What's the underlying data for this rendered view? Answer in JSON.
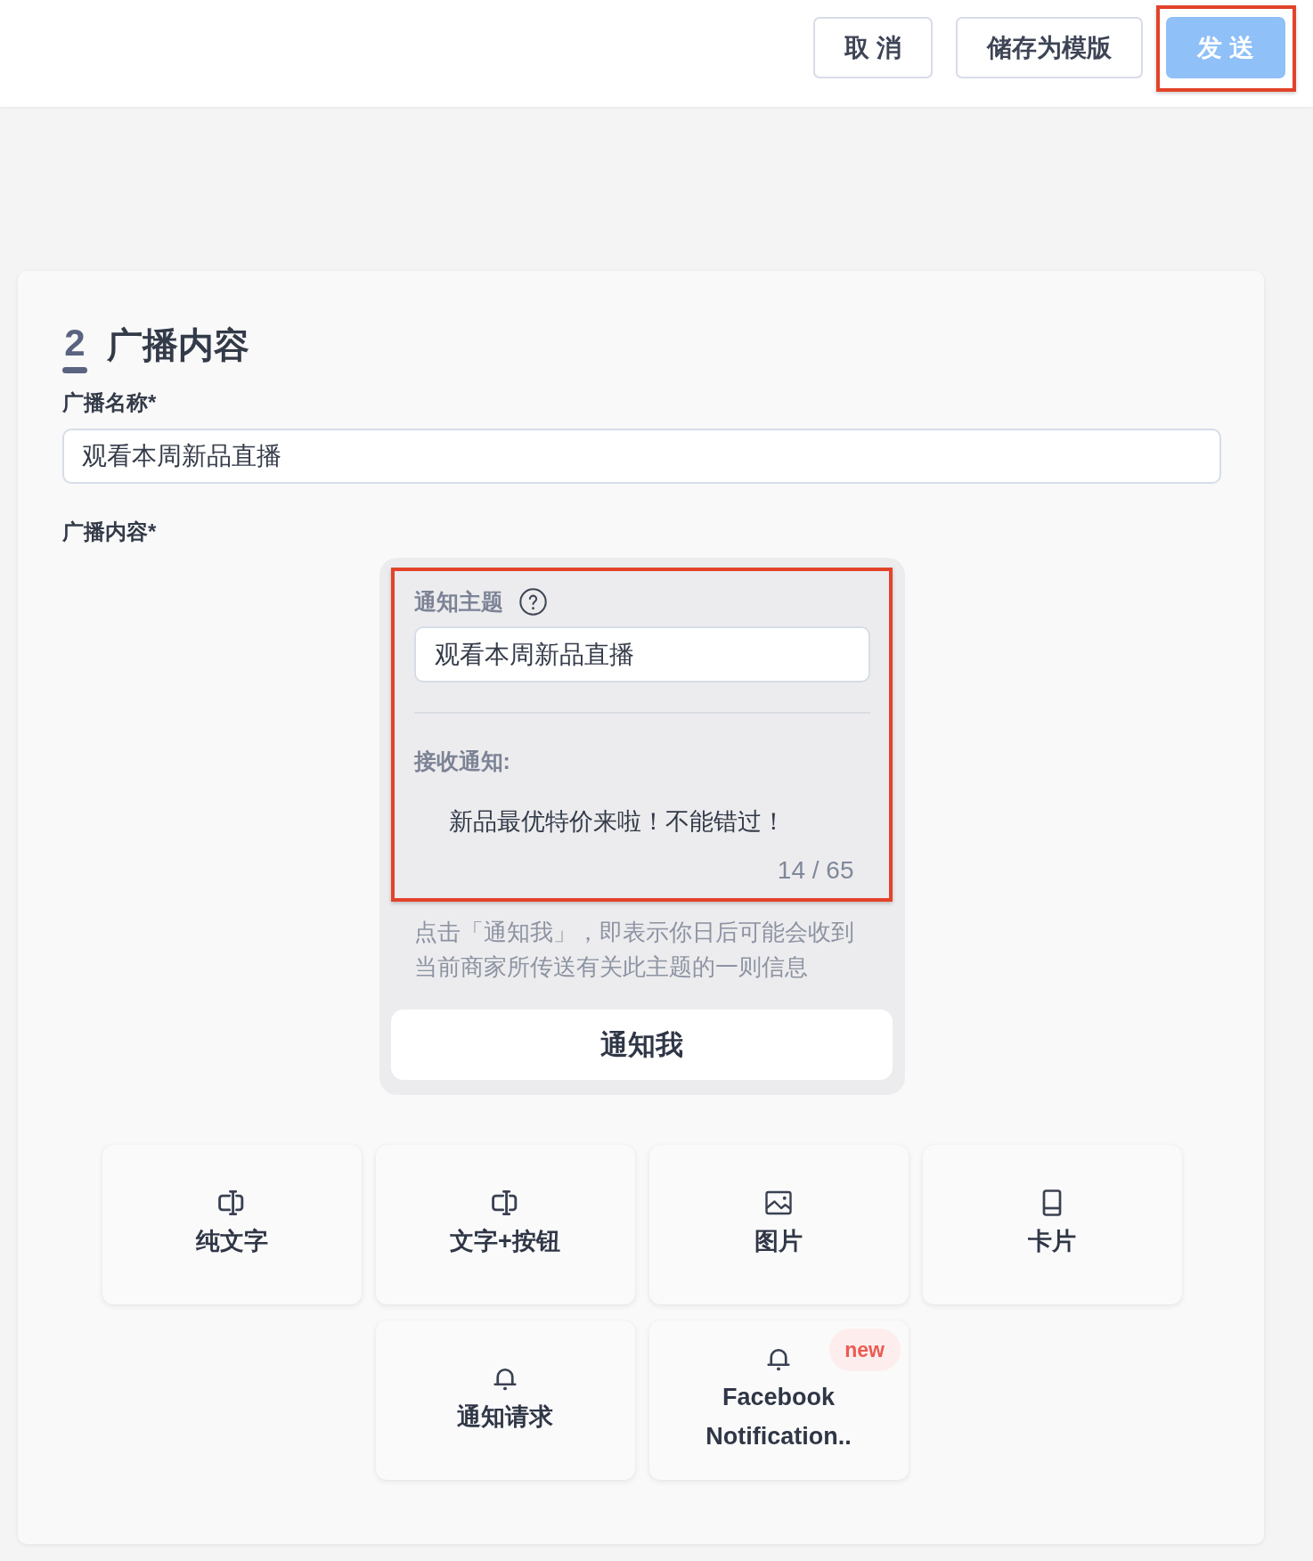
{
  "toolbar": {
    "buttons": [
      {
        "label": "取 消",
        "kind": "default",
        "highlighted": false
      },
      {
        "label": "储存为模版",
        "kind": "default",
        "highlighted": false
      },
      {
        "label": "发 送",
        "kind": "primary",
        "highlighted": true
      }
    ]
  },
  "section": {
    "step": "2",
    "title": "广播内容",
    "name_field": {
      "label": "广播名称*",
      "value": "观看本周新品直播"
    },
    "content_label": "广播内容*",
    "preview": {
      "highlighted": true,
      "subject_label": "通知主题",
      "subject_value": "观看本周新品直播",
      "receive_label": "接收通知:",
      "message": "新品最优特价来啦！不能错过！",
      "counter": "14 / 65",
      "disclaimer": "点击「通知我」，即表示你日后可能会收到当前商家所传送有关此主题的一则信息",
      "action_button": "通知我"
    },
    "message_types": [
      {
        "kind": "text",
        "label": "纯文字"
      },
      {
        "kind": "text_button",
        "label": "文字+按钮"
      },
      {
        "kind": "image",
        "label": "图片"
      },
      {
        "kind": "card",
        "label": "卡片"
      },
      {
        "kind": "notification",
        "label": "通知请求"
      },
      {
        "kind": "notification",
        "label": "Facebook Notification..",
        "badge": "new"
      }
    ]
  }
}
